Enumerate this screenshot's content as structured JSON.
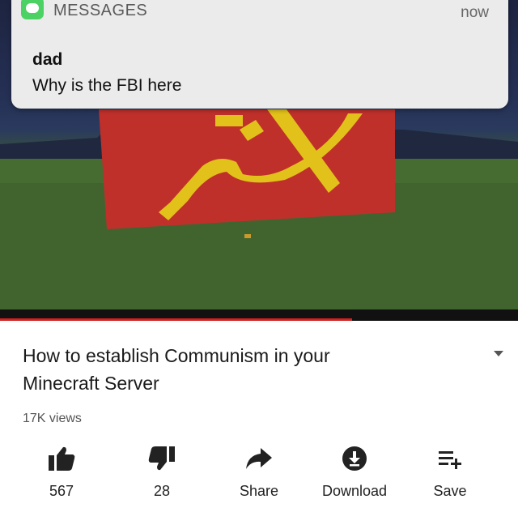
{
  "notification": {
    "app_name": "MESSAGES",
    "time": "now",
    "sender": "dad",
    "message": "Why is the FBI here"
  },
  "video": {
    "progress": 0.68
  },
  "info": {
    "title_line1": "How to establish Communism in your",
    "title_line2": "Minecraft Server",
    "views": "17K views"
  },
  "actions": [
    {
      "label": "567",
      "icon": "thumbs-up-icon"
    },
    {
      "label": "28",
      "icon": "thumbs-down-icon"
    },
    {
      "label": "Share",
      "icon": "share-icon"
    },
    {
      "label": "Download",
      "icon": "download-icon"
    },
    {
      "label": "Save",
      "icon": "save-icon"
    }
  ],
  "colors": {
    "flag_red": "#c0302b",
    "flag_yellow": "#e2c21a",
    "progress_red": "#d32020",
    "imessage_green": "#4cd264"
  }
}
